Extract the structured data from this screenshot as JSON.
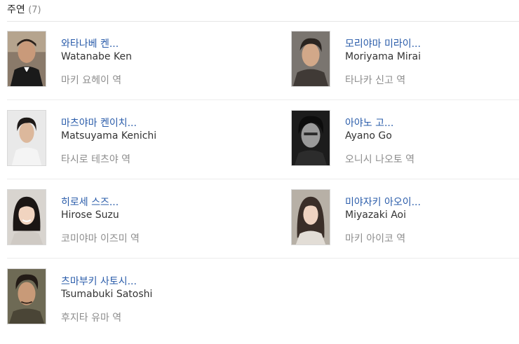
{
  "section": {
    "title": "주연",
    "count": "(7)"
  },
  "cast": [
    {
      "name_ko": "와타나베 켄...",
      "name_en": "Watanabe Ken",
      "role": "마키 요헤이 역",
      "photo_icon": "actor-photo"
    },
    {
      "name_ko": "모리야마 미라이...",
      "name_en": "Moriyama Mirai",
      "role": "타나카 신고 역",
      "photo_icon": "actor-photo"
    },
    {
      "name_ko": "마츠야마 켄이치...",
      "name_en": "Matsuyama Kenichi",
      "role": "타시로 테츠야 역",
      "photo_icon": "actor-photo"
    },
    {
      "name_ko": "아야노 고...",
      "name_en": "Ayano Go",
      "role": "오니시 나오토 역",
      "photo_icon": "actor-photo"
    },
    {
      "name_ko": "히로세 스즈...",
      "name_en": "Hirose Suzu",
      "role": "코미야마 이즈미 역",
      "photo_icon": "actress-photo"
    },
    {
      "name_ko": "미야자키 아오이...",
      "name_en": "Miyazaki Aoi",
      "role": "마키 아이코 역",
      "photo_icon": "actress-photo"
    },
    {
      "name_ko": "츠마부키 사토시...",
      "name_en": "Tsumabuki Satoshi",
      "role": "후지타 유마 역",
      "photo_icon": "actor-photo"
    }
  ],
  "colors": {
    "link": "#2a5caa",
    "text": "#333333",
    "muted": "#8d8d8d",
    "divider": "#ececec"
  }
}
